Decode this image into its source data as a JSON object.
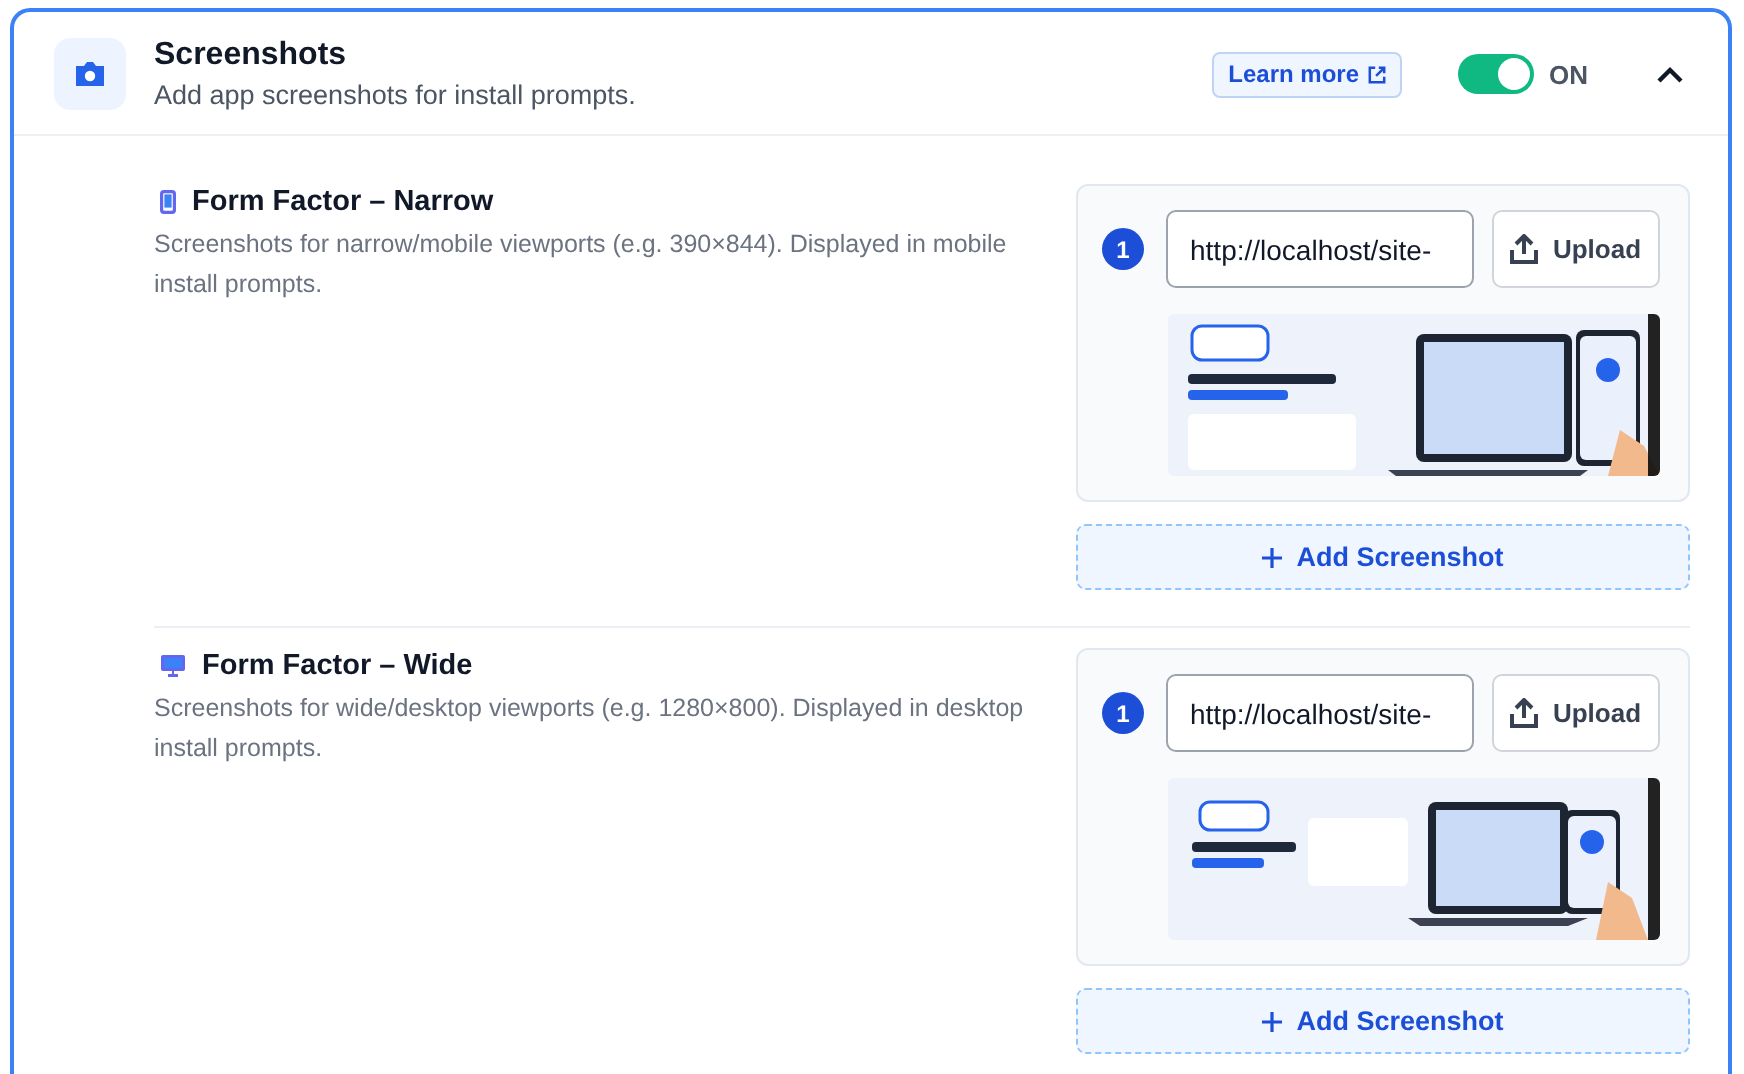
{
  "section": {
    "title": "Screenshots",
    "subtitle": "Add app screenshots for install prompts.",
    "learn_more": "Learn more",
    "toggle": {
      "on": true,
      "label": "ON"
    },
    "expanded": true
  },
  "form_factors": [
    {
      "kind": "narrow",
      "title": "Form Factor – Narrow",
      "description": "Screenshots for narrow/mobile viewports (e.g. 390×844). Displayed in mobile install prompts.",
      "screenshots": [
        {
          "number": "1",
          "url": "http://localhost/site-",
          "upload": "Upload"
        }
      ],
      "add_button": "Add Screenshot"
    },
    {
      "kind": "wide",
      "title": "Form Factor – Wide",
      "description": "Screenshots for wide/desktop viewports (e.g. 1280×800). Displayed in desktop install prompts.",
      "screenshots": [
        {
          "number": "1",
          "url": "http://localhost/site-",
          "upload": "Upload"
        }
      ],
      "add_button": "Add Screenshot"
    }
  ]
}
